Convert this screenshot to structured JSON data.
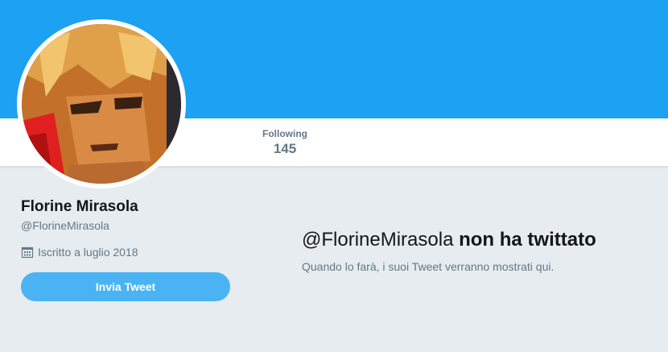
{
  "colors": {
    "banner": "#1da1f2",
    "page_background": "#e6ecf0",
    "button": "#4ab3f4",
    "secondary_text": "#657786",
    "primary_text": "#14171a"
  },
  "nav": {
    "stats": [
      {
        "label": "Following",
        "value": "145"
      }
    ]
  },
  "profile": {
    "avatar_icon": "avatar-image",
    "display_name": "Florine Mirasola",
    "handle": "@FlorineMirasola",
    "joined_icon": "calendar-icon",
    "joined": "Iscritto a luglio 2018",
    "tweet_button": "Invia Tweet"
  },
  "timeline": {
    "empty_handle": "@FlorineMirasola",
    "empty_title_suffix": "non ha twittato",
    "empty_subtitle": "Quando lo farà, i suoi Tweet verranno mostrati qui."
  }
}
